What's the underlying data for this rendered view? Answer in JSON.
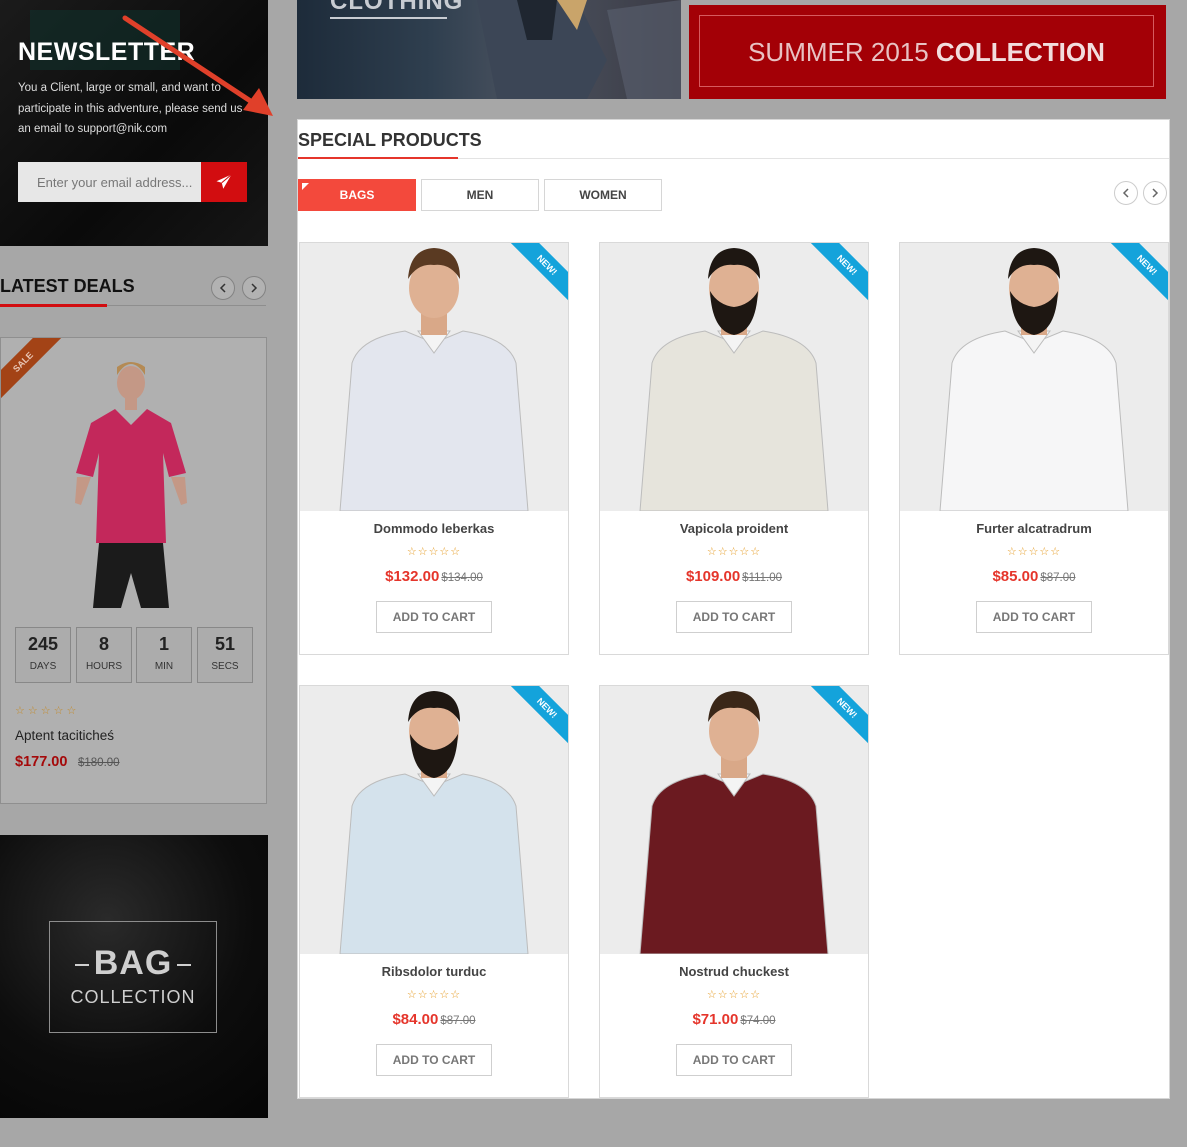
{
  "newsletter": {
    "title": "NEWSLETTER",
    "description": "You a Client, large or small, and want to participate in this adventure, please send us an email to support@nik.com",
    "email_placeholder": "Enter your email address...",
    "send_icon": "paper-plane-icon"
  },
  "latest_deals": {
    "title": "LATEST DEALS",
    "badge": "SALE",
    "countdown": [
      {
        "value": "245",
        "label": "DAYS"
      },
      {
        "value": "8",
        "label": "HOURS"
      },
      {
        "value": "1",
        "label": "MIN"
      },
      {
        "value": "51",
        "label": "SECS"
      }
    ],
    "rating_stars": "☆☆☆☆☆",
    "product_name": "Aptent taciticheś",
    "price": "$177.00",
    "old_price": "$180.00"
  },
  "bag_banner": {
    "title": "BAG",
    "subtitle": "COLLECTION"
  },
  "clothing_banner": {
    "text": "CLOTHING"
  },
  "summer_banner": {
    "text_light": "SUMMER 2015 ",
    "text_bold": "COLLECTION"
  },
  "special_products": {
    "title": "SPECIAL PRODUCTS",
    "tabs": [
      "BAGS",
      "MEN",
      "WOMEN"
    ],
    "active_tab": "BAGS",
    "badge": "NEW!",
    "add_to_cart": "ADD TO CART",
    "products": [
      {
        "name": "Dommodo leberkas",
        "stars": "☆☆☆☆☆",
        "price": "$132.00",
        "old_price": "$134.00",
        "shirt": "#e3e6ee"
      },
      {
        "name": "Vapicola proident",
        "stars": "☆☆☆☆☆",
        "price": "$109.00",
        "old_price": "$111.00",
        "shirt": "#e6e4dc"
      },
      {
        "name": "Furter alcatradrum",
        "stars": "☆☆☆☆☆",
        "price": "$85.00",
        "old_price": "$87.00",
        "shirt": "#f6f6f7"
      },
      {
        "name": "Ribsdolor turduc",
        "stars": "☆☆☆☆☆",
        "price": "$84.00",
        "old_price": "$87.00",
        "shirt": "#d4e2ec"
      },
      {
        "name": "Nostrud chuckest",
        "stars": "☆☆☆☆☆",
        "price": "$71.00",
        "old_price": "$74.00",
        "shirt": "#6b1a20"
      }
    ]
  },
  "colors": {
    "accent": "#e5352b",
    "new_badge": "#14a3db",
    "summer": "#a30006"
  }
}
